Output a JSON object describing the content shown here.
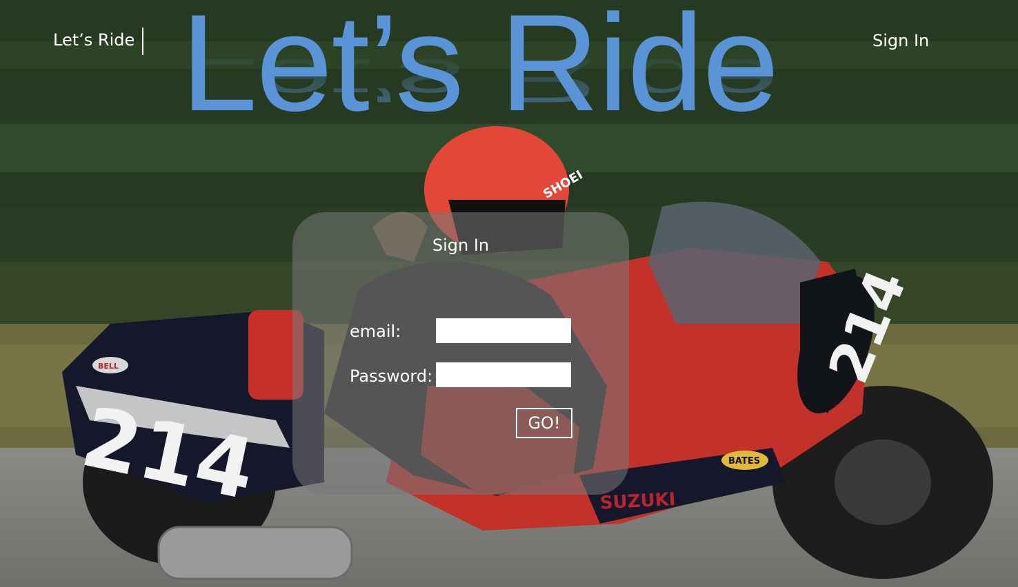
{
  "nav": {
    "brand": "Let’s Ride",
    "signin": "Sign In"
  },
  "hero": {
    "title": "Let’s Ride"
  },
  "bike": {
    "number": "214",
    "helmet_brand": "SHOEI",
    "fairing_brand": "SUZUKI",
    "tail_badge": "BELL",
    "fork_badge": "BATES"
  },
  "signin_form": {
    "title": "Sign In",
    "email_label": "email:",
    "email_value": "",
    "password_label": "Password:",
    "password_value": "",
    "submit_label": "GO!"
  },
  "colors": {
    "title_blue": "#5b94d6",
    "bike_red": "#d13a2e",
    "helmet_red": "#e2473a",
    "card_bg": "rgba(120,120,120,0.55)"
  }
}
